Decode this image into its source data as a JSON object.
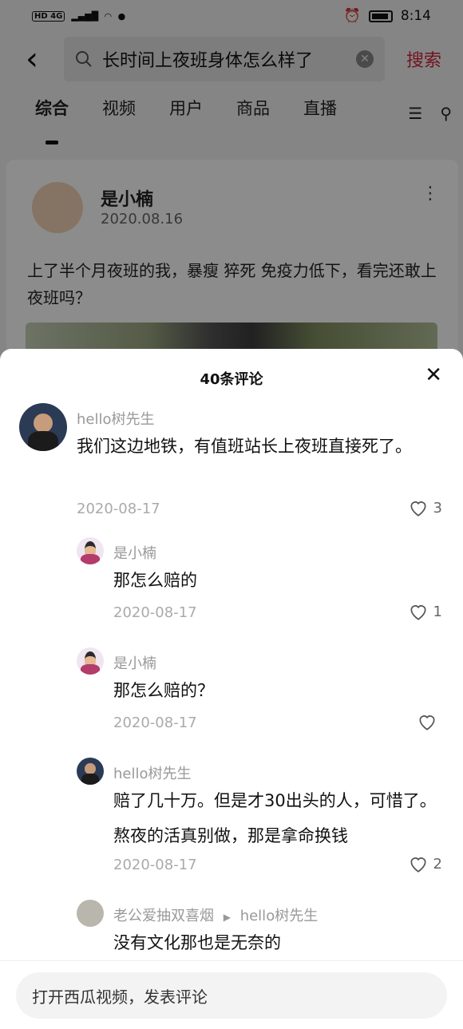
{
  "status_bar": {
    "network": "HD 4G",
    "time": "8:14"
  },
  "search": {
    "back_icon": "chevron-left-icon",
    "query": "长时间上夜班身体怎么样了",
    "button": "搜索"
  },
  "tabs": [
    {
      "label": "综合",
      "active": true
    },
    {
      "label": "视频",
      "active": false
    },
    {
      "label": "用户",
      "active": false
    },
    {
      "label": "商品",
      "active": false
    },
    {
      "label": "直播",
      "active": false
    }
  ],
  "post": {
    "author": "是小楠",
    "date": "2020.08.16",
    "text": "上了半个月夜班的我，暴瘦 猝死 免疫力低下，看完还敢上夜班吗？"
  },
  "comments_sheet": {
    "title": "40条评论",
    "comments": [
      {
        "author": "hello树先生",
        "text": "我们这边地铁，有值班站长上夜班直接死了。",
        "date": "2020-08-17",
        "likes": "3"
      },
      {
        "author": "是小楠",
        "text": "那怎么赔的",
        "date": "2020-08-17",
        "likes": "1"
      },
      {
        "author": "是小楠",
        "text": "那怎么赔的？",
        "date": "2020-08-17",
        "likes": ""
      },
      {
        "author": "hello树先生",
        "text": "赔了几十万。但是才30出头的人，可惜了。熬夜的活真别做，那是拿命换钱",
        "date": "2020-08-17",
        "likes": "2"
      },
      {
        "author": "老公爱抽双喜烟",
        "reply_to": "hello树先生",
        "text": "没有文化那也是无奈的"
      }
    ],
    "input_placeholder": "打开西瓜视频，发表评论"
  },
  "colors": {
    "accent": "#d4233a"
  }
}
